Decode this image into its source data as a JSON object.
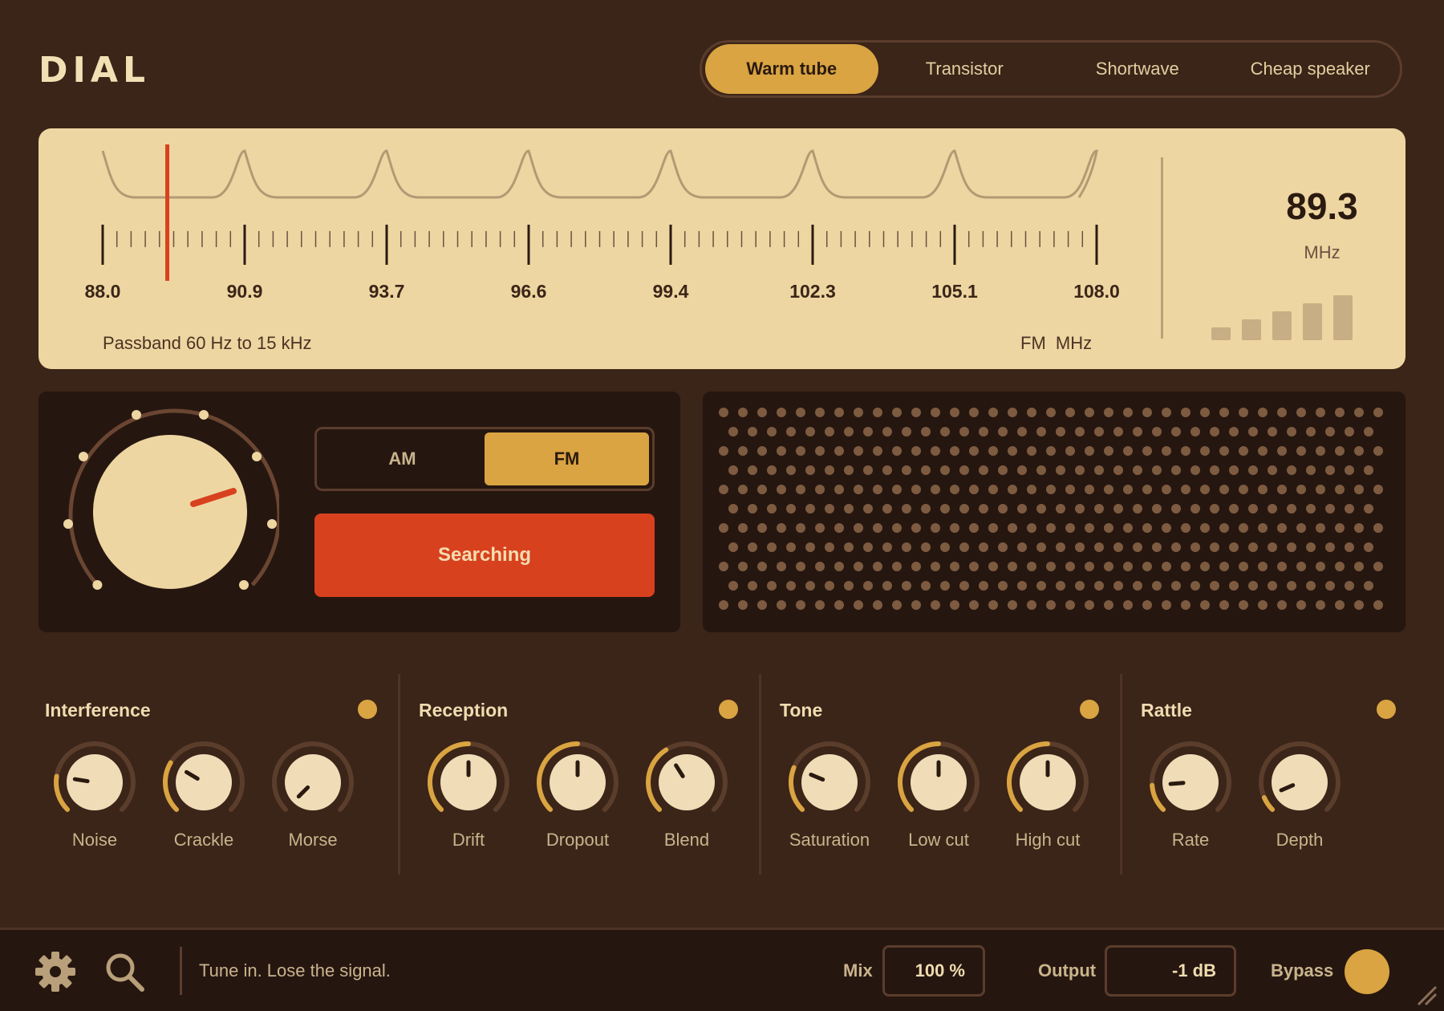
{
  "app": {
    "logo": "DIAL"
  },
  "presets": [
    {
      "label": "Warm tube",
      "active": true
    },
    {
      "label": "Transistor",
      "active": false
    },
    {
      "label": "Shortwave",
      "active": false
    },
    {
      "label": "Cheap speaker",
      "active": false
    }
  ],
  "scale": {
    "ticks": [
      "88.0",
      "90.9",
      "93.7",
      "96.6",
      "99.4",
      "102.3",
      "105.1",
      "108.0"
    ],
    "range_mhz": [
      88.0,
      108.0
    ],
    "needle_mhz": 89.3,
    "passband": "Passband 60 Hz to 15 kHz",
    "band_unit": "FM  MHz",
    "readout": "89.3",
    "readout_unit": "MHz",
    "signal_bars": 5
  },
  "tuner": {
    "bands": [
      {
        "label": "AM",
        "active": false
      },
      {
        "label": "FM",
        "active": true
      }
    ],
    "search_label": "Searching"
  },
  "sections": [
    {
      "title": "Interference",
      "enabled": true,
      "knobs": [
        {
          "label": "Noise",
          "value": 0.2
        },
        {
          "label": "Crackle",
          "value": 0.28
        },
        {
          "label": "Morse",
          "value": 0.0
        }
      ]
    },
    {
      "title": "Reception",
      "enabled": true,
      "knobs": [
        {
          "label": "Drift",
          "value": 0.5
        },
        {
          "label": "Dropout",
          "value": 0.5
        },
        {
          "label": "Blend",
          "value": 0.38
        }
      ]
    },
    {
      "title": "Tone",
      "enabled": true,
      "knobs": [
        {
          "label": "Saturation",
          "value": 0.25
        },
        {
          "label": "Low cut",
          "value": 0.5
        },
        {
          "label": "High cut",
          "value": 0.5
        }
      ]
    },
    {
      "title": "Rattle",
      "enabled": true,
      "knobs": [
        {
          "label": "Rate",
          "value": 0.15
        },
        {
          "label": "Depth",
          "value": 0.08
        }
      ]
    }
  ],
  "footer": {
    "tagline": "Tune in. Lose the signal.",
    "mix_label": "Mix",
    "mix_value": "100 %",
    "output_label": "Output",
    "output_value": "-1 dB",
    "bypass_label": "Bypass"
  },
  "colors": {
    "background": "#3b2418",
    "accent": "#d9a441",
    "needle": "#d8411e",
    "scale_panel": "#eed6a2"
  },
  "icons": [
    "gear-icon",
    "search-icon",
    "resize-grip-icon"
  ]
}
